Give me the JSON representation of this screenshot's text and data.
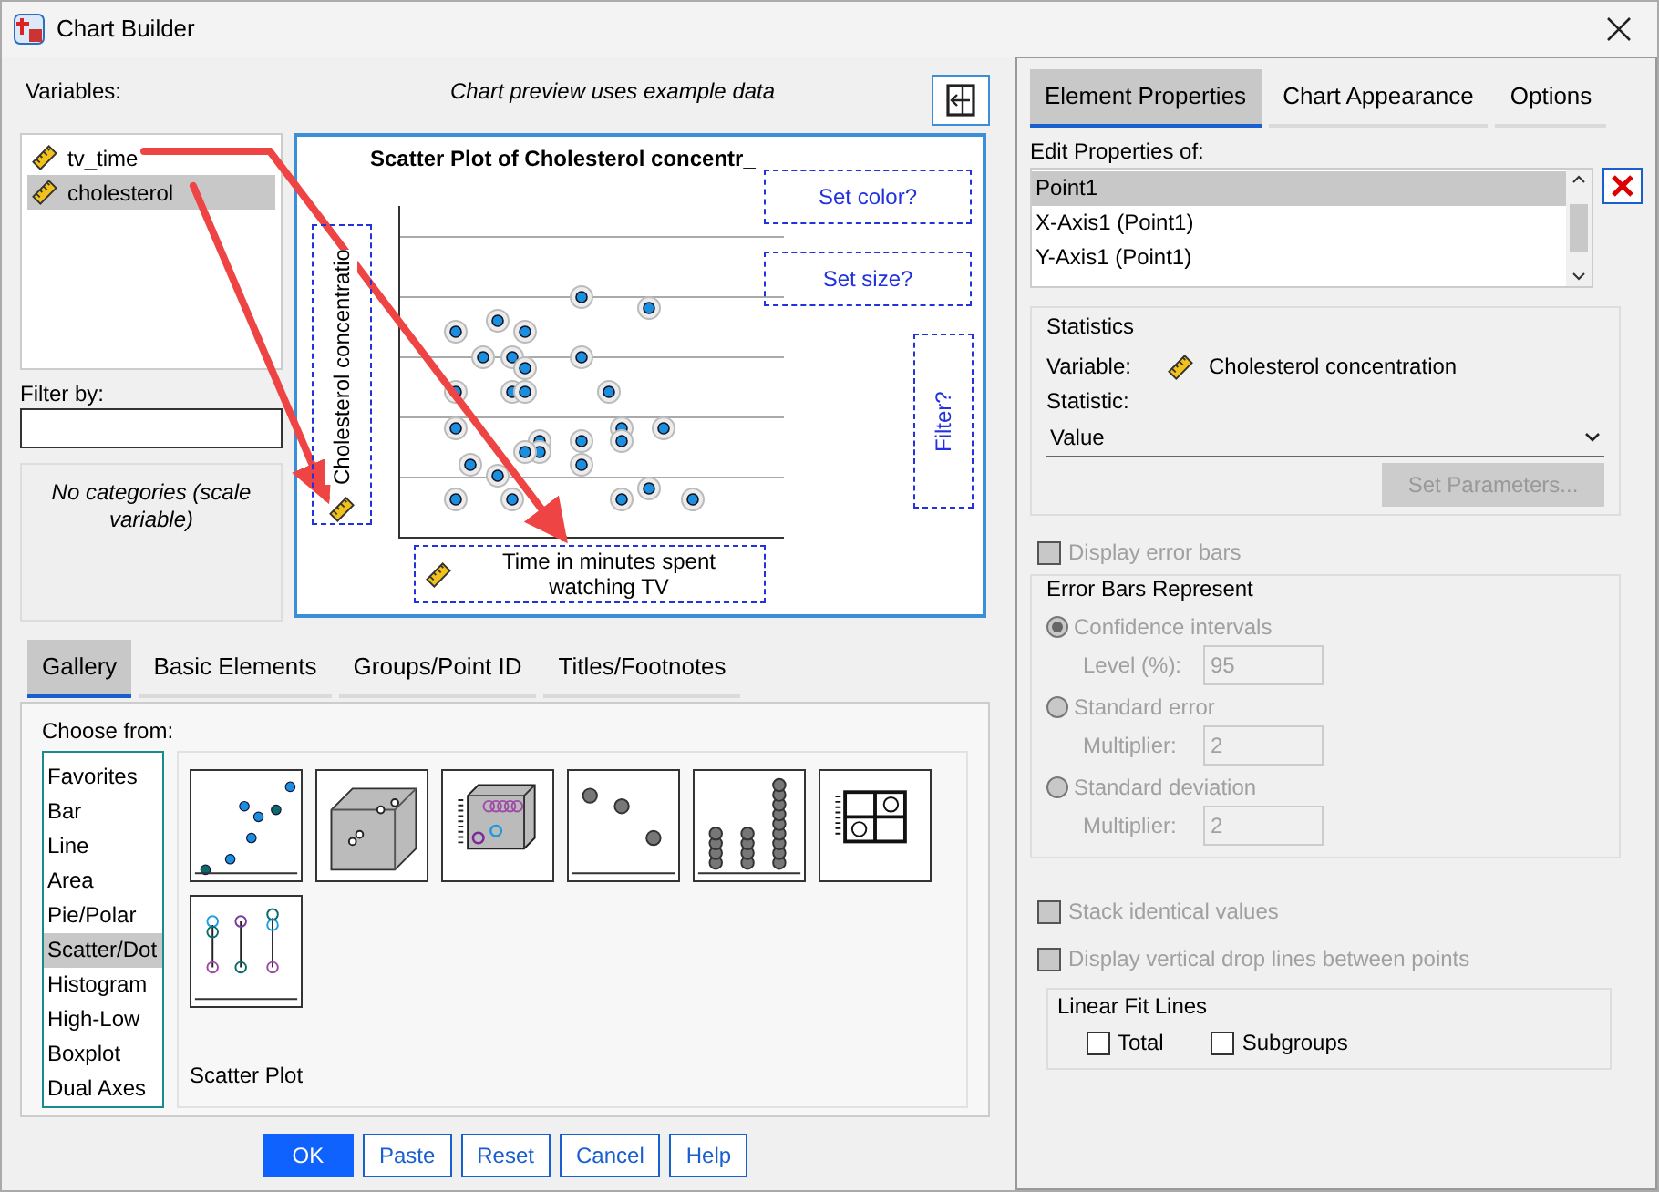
{
  "window": {
    "title": "Chart Builder"
  },
  "variables": {
    "label": "Variables:",
    "items": [
      {
        "name": "tv_time",
        "selected": false
      },
      {
        "name": "cholesterol",
        "selected": true
      }
    ]
  },
  "preview_note": "Chart preview uses example data",
  "filter": {
    "label": "Filter by:"
  },
  "categories_note": "No categories (scale variable)",
  "preview": {
    "title": "Scatter Plot of Cholesterol concentr_",
    "y_axis_label": "Cholesterol concentratio",
    "x_axis_label": "Time in minutes spent watching TV",
    "color_zone": "Set color?",
    "size_zone": "Set size?",
    "filter_zone": "Filter?"
  },
  "gallery_tabs": [
    {
      "label": "Gallery",
      "selected": true
    },
    {
      "label": "Basic Elements",
      "selected": false
    },
    {
      "label": "Groups/Point ID",
      "selected": false
    },
    {
      "label": "Titles/Footnotes",
      "selected": false
    }
  ],
  "choose_from": {
    "label": "Choose from:",
    "items": [
      {
        "label": "Favorites",
        "selected": false
      },
      {
        "label": "Bar",
        "selected": false
      },
      {
        "label": "Line",
        "selected": false
      },
      {
        "label": "Area",
        "selected": false
      },
      {
        "label": "Pie/Polar",
        "selected": false
      },
      {
        "label": "Scatter/Dot",
        "selected": true
      },
      {
        "label": "Histogram",
        "selected": false
      },
      {
        "label": "High-Low",
        "selected": false
      },
      {
        "label": "Boxplot",
        "selected": false
      },
      {
        "label": "Dual Axes",
        "selected": false
      }
    ]
  },
  "thumbnails": [
    {
      "kind": "simple"
    },
    {
      "kind": "cube"
    },
    {
      "kind": "grouped3d"
    },
    {
      "kind": "dot"
    },
    {
      "kind": "stacked"
    },
    {
      "kind": "matrix"
    },
    {
      "kind": "dropline"
    }
  ],
  "gallery_caption": "Scatter Plot",
  "buttons": [
    {
      "label": "OK",
      "primary": true
    },
    {
      "label": "Paste",
      "primary": false
    },
    {
      "label": "Reset",
      "primary": false
    },
    {
      "label": "Cancel",
      "primary": false
    },
    {
      "label": "Help",
      "primary": false
    }
  ],
  "properties_tabs": [
    {
      "label": "Element Properties",
      "selected": true
    },
    {
      "label": "Chart Appearance",
      "selected": false
    },
    {
      "label": "Options",
      "selected": false
    }
  ],
  "edit_properties": {
    "label": "Edit Properties of:",
    "items": [
      {
        "label": "Point1",
        "selected": true
      },
      {
        "label": "X-Axis1 (Point1)",
        "selected": false
      },
      {
        "label": "Y-Axis1 (Point1)",
        "selected": false
      }
    ]
  },
  "statistics": {
    "title": "Statistics",
    "variable_label": "Variable:",
    "variable": "Cholesterol concentration",
    "statistic_label": "Statistic:",
    "statistic": "Value",
    "set_parameters": {
      "label": "Set Parameters...",
      "disabled": true
    }
  },
  "display_error_bars": {
    "label": "Display error bars",
    "checked": false,
    "disabled": true
  },
  "error_bars": {
    "title": "Error Bars Represent",
    "disabled": true,
    "options": [
      {
        "label": "Confidence intervals",
        "selected": true,
        "field_label": "Level (%):",
        "field_value": "95"
      },
      {
        "label": "Standard error",
        "selected": false,
        "field_label": "Multiplier:",
        "field_value": "2"
      },
      {
        "label": "Standard deviation",
        "selected": false,
        "field_label": "Multiplier:",
        "field_value": "2"
      }
    ]
  },
  "stack_identical": {
    "label": "Stack identical values",
    "checked": false,
    "disabled": true
  },
  "drop_lines": {
    "label": "Display vertical drop lines between points",
    "checked": false,
    "disabled": true
  },
  "linear_fit": {
    "title": "Linear Fit Lines",
    "options": [
      {
        "label": "Total",
        "checked": false
      },
      {
        "label": "Subgroups",
        "checked": false
      }
    ]
  }
}
